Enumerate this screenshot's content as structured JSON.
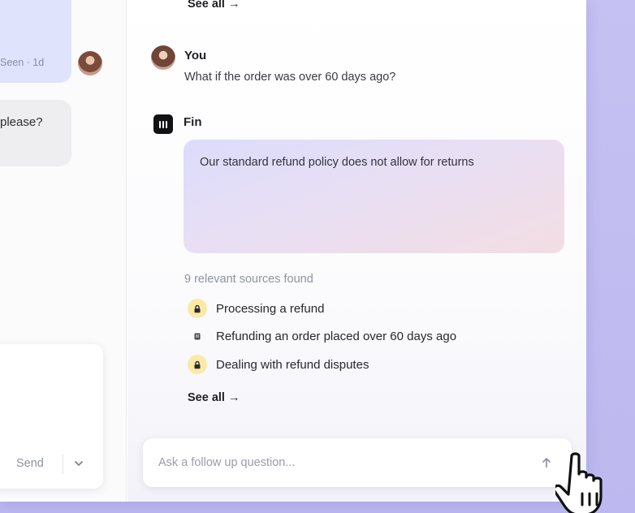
{
  "left_panel": {
    "seen_text": "Seen · 1d",
    "partial_message": "please?",
    "send_label": "Send",
    "icons": {
      "dropdown": "chevron-down-icon"
    }
  },
  "copilot": {
    "top_see_all": "See all",
    "user_message": {
      "author": "You",
      "text": "What if the order was over 60 days ago?"
    },
    "fin_message": {
      "author": "Fin",
      "answer": "Our standard refund policy does not allow for returns"
    },
    "sources": {
      "title": "9 relevant sources found",
      "items": [
        {
          "label": "Processing a refund",
          "icon": "lock-icon"
        },
        {
          "label": "Refunding an order placed over 60 days ago",
          "icon": "document-icon"
        },
        {
          "label": "Dealing with refund disputes",
          "icon": "lock-icon"
        }
      ],
      "see_all": "See all"
    },
    "followup": {
      "placeholder": "Ask a follow up question...",
      "value": ""
    }
  },
  "colors": {
    "background": "#c5c1f2",
    "answer_gradient_start": "#dcdcfb",
    "answer_gradient_end": "#f3dde3",
    "lock_badge": "#fbe9a8"
  }
}
